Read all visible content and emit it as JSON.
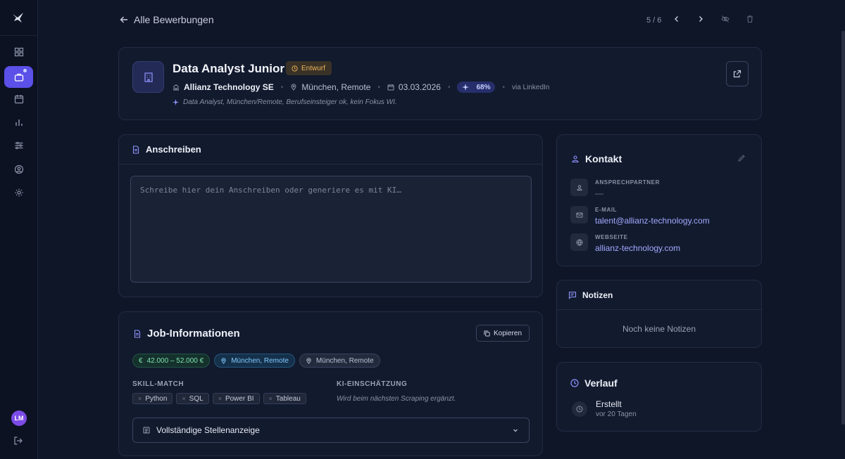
{
  "sidebar": {
    "avatar_initials": "LM",
    "icons": [
      "logo-icon",
      "dashboard-icon",
      "applications-icon",
      "calendar-icon",
      "stats-icon",
      "filters-icon",
      "profile-icon",
      "settings-icon",
      "logout-icon"
    ]
  },
  "topbar": {
    "back_label": "Alle Bewerbungen",
    "pager": "5 / 6"
  },
  "job": {
    "title": "Data Analyst Junior",
    "status": "Entwurf",
    "company": "Allianz Technology SE",
    "location": "München, Remote",
    "date": "03.03.2026",
    "match": "68%",
    "source": "via LinkedIn",
    "ai_summary": "Data Analyst, München/Remote, Berufseinsteiger ok, kein Fokus WI."
  },
  "letter": {
    "title": "Anschreiben",
    "placeholder": "Schreibe hier dein Anschreiben oder generiere es mit KI…"
  },
  "jobinfo": {
    "title": "Job-Informationen",
    "copy_label": "Kopieren",
    "salary": "42.000 – 52.000 €",
    "location_primary": "München, Remote",
    "location_secondary": "München, Remote",
    "skill_match_label": "SKILL-MATCH",
    "skills": [
      "Python",
      "SQL",
      "Power BI",
      "Tableau"
    ],
    "ai_label": "KI-EINSCHÄTZUNG",
    "ai_note": "Wird beim nächsten Scraping ergänzt.",
    "full_posting_label": "Vollständige Stellenanzeige"
  },
  "contact": {
    "title": "Kontakt",
    "person_label": "ANSPRECHPARTNER",
    "person_value": "—",
    "email_label": "E-MAIL",
    "email_value": "talent@allianz-technology.com",
    "website_label": "WEBSEITE",
    "website_value": "allianz-technology.com"
  },
  "notes": {
    "title": "Notizen",
    "empty": "Noch keine Notizen"
  },
  "history": {
    "title": "Verlauf",
    "entry_title": "Erstellt",
    "entry_time": "vor 20 Tagen"
  },
  "colors": {
    "accent": "#5b50e8",
    "background": "#0f1628",
    "card": "#121a2e",
    "link": "#a3a9ff",
    "draft": "#e9b25a",
    "salary": "#7ee2b0"
  }
}
